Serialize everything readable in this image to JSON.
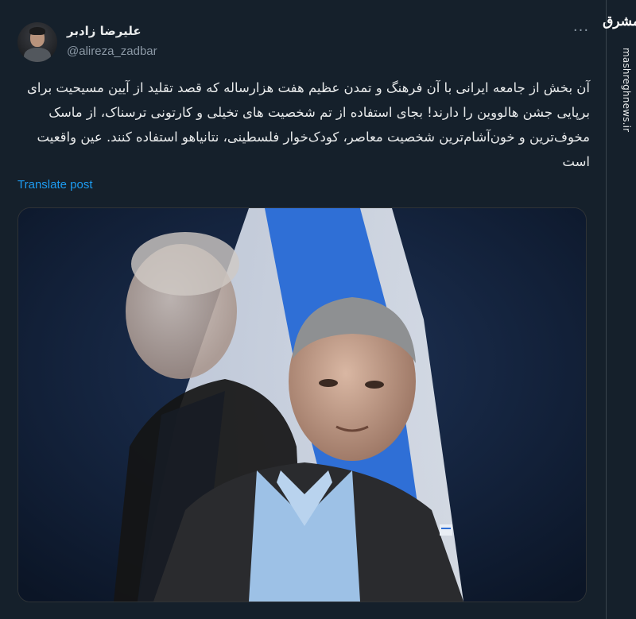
{
  "tweet": {
    "author_name": "علیرضا زادبر",
    "handle": "@alireza_zadbar",
    "more_icon": "···",
    "text": "آن بخش از جامعه ایرانی با آن فرهنگ و تمدن عظیم هفت هزارساله که قصد تقلید از آیین مسیحیت برای برپایی جشن هالووین را دارند! بجای استفاده از تم شخصیت های تخیلی و کارتونی ترسناک، از ماسک مخوف‌ترین و خون‌آشام‌ترین شخصیت معاصر، کودک‌خوار فلسطینی، نتانیاهو استفاده کنند. عین واقعیت است",
    "translate_label": "Translate post"
  },
  "watermark": {
    "logo_text": "مشرق",
    "site": "mashreghnews.ir"
  },
  "colors": {
    "background": "#15202b",
    "accent": "#1d9bf0",
    "muted": "#8b98a5"
  },
  "media": {
    "icon": "photo-icon"
  }
}
